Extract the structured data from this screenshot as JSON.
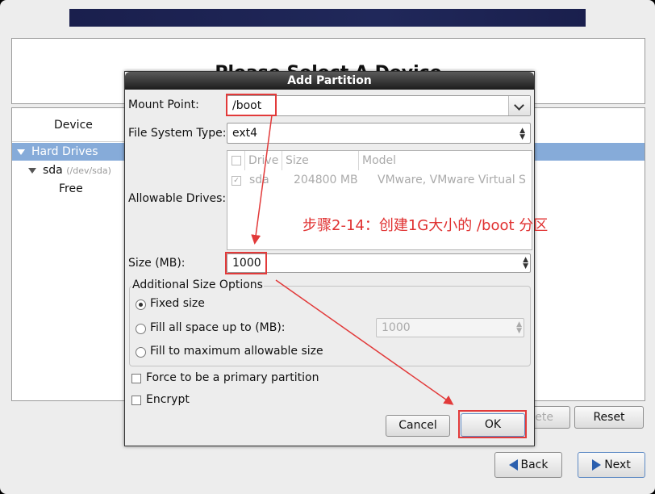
{
  "background_title": "Please Select A Device",
  "device_tree": {
    "header": "Device",
    "items": [
      {
        "label": "Hard Drives"
      },
      {
        "label": "sda",
        "sub": "(/dev/sda)"
      },
      {
        "label": "Free"
      }
    ]
  },
  "main_buttons": {
    "delete": "Delete",
    "reset": "Reset",
    "back": "Back",
    "next": "Next"
  },
  "dialog": {
    "title": "Add Partition",
    "mount_point": {
      "label": "Mount Point:",
      "value": "/boot"
    },
    "fs_type": {
      "label": "File System Type:",
      "value": "ext4"
    },
    "drives": {
      "label": "Allowable Drives:",
      "columns": [
        "Drive",
        "Size",
        "Model"
      ],
      "rows": [
        {
          "checked": true,
          "drive": "sda",
          "size": "204800 MB",
          "model": "VMware, VMware Virtual S"
        }
      ]
    },
    "size": {
      "label": "Size (MB):",
      "value": "1000"
    },
    "additional": {
      "title": "Additional Size Options",
      "fixed": "Fixed size",
      "fill_up_to": "Fill all space up to (MB):",
      "fill_up_to_value": "1000",
      "fill_max": "Fill to maximum allowable size",
      "selected": "fixed"
    },
    "force_primary": "Force to be a primary partition",
    "encrypt": "Encrypt",
    "cancel": "Cancel",
    "ok": "OK"
  },
  "annotation": "步骤2-14：创建1G大小的 /boot 分区",
  "colors": {
    "highlight": "#e23a3a",
    "selection": "#86abd9"
  }
}
